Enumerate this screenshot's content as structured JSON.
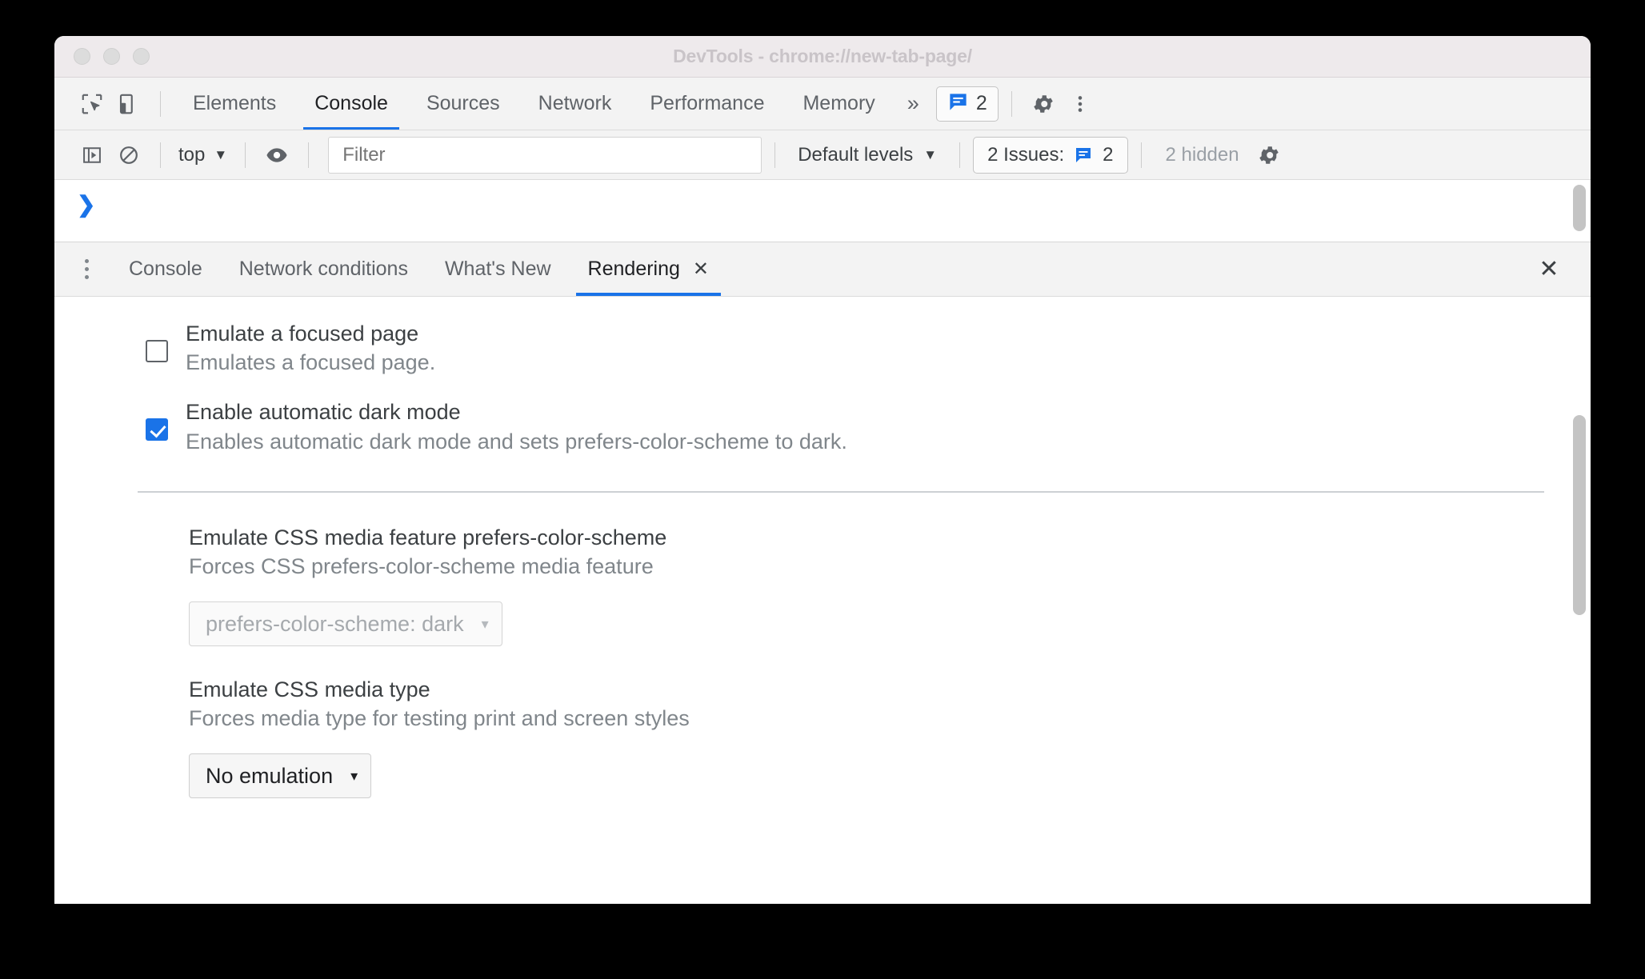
{
  "window": {
    "title": "DevTools - chrome://new-tab-page/",
    "traffic_lights": [
      "close",
      "minimize",
      "zoom"
    ]
  },
  "main_toolbar": {
    "inspect_icon": "inspect-element-icon",
    "device_icon": "device-toolbar-icon",
    "tabs": [
      {
        "label": "Elements",
        "active": false
      },
      {
        "label": "Console",
        "active": true
      },
      {
        "label": "Sources",
        "active": false
      },
      {
        "label": "Network",
        "active": false
      },
      {
        "label": "Performance",
        "active": false
      },
      {
        "label": "Memory",
        "active": false
      }
    ],
    "more_tabs": "»",
    "issues_badge": {
      "icon": "issues-speech-bubble-icon",
      "count": "2"
    },
    "settings_icon": "gear-icon",
    "more_options_icon": "kebab-menu-icon"
  },
  "filter_toolbar": {
    "sidebar_toggle_icon": "console-sidebar-icon",
    "clear_console_icon": "clear-console-icon",
    "context": {
      "label": "top",
      "caret": "▼"
    },
    "eye_icon": "live-expression-eye-icon",
    "filter": {
      "placeholder": "Filter",
      "value": ""
    },
    "levels": {
      "label": "Default levels",
      "caret": "▼"
    },
    "issues": {
      "label": "2 Issues:",
      "icon": "issues-speech-bubble-icon",
      "count": "2"
    },
    "hidden": "2 hidden",
    "settings_icon": "gear-icon"
  },
  "console": {
    "prompt": "❯"
  },
  "drawer": {
    "more_tools_icon": "kebab-menu-icon",
    "tabs": [
      {
        "label": "Console",
        "active": false,
        "closable": false
      },
      {
        "label": "Network conditions",
        "active": false,
        "closable": false
      },
      {
        "label": "What's New",
        "active": false,
        "closable": false
      },
      {
        "label": "Rendering",
        "active": true,
        "closable": true,
        "close": "✕"
      }
    ],
    "close_icon": "✕"
  },
  "rendering": {
    "checkboxes": [
      {
        "title": "Emulate a focused page",
        "description": "Emulates a focused page.",
        "checked": false
      },
      {
        "title": "Enable automatic dark mode",
        "description": "Enables automatic dark mode and sets prefers-color-scheme to dark.",
        "checked": true
      }
    ],
    "sections": [
      {
        "title": "Emulate CSS media feature prefers-color-scheme",
        "description": "Forces CSS prefers-color-scheme media feature",
        "select": {
          "value": "prefers-color-scheme: dark",
          "caret": "▾",
          "disabled": true
        }
      },
      {
        "title": "Emulate CSS media type",
        "description": "Forces media type for testing print and screen styles",
        "select": {
          "value": "No emulation",
          "caret": "▾",
          "disabled": false
        }
      }
    ]
  },
  "colors": {
    "accent": "#1a73e8",
    "titlebar": "#eeeaec",
    "toolbar": "#f3f3f3",
    "text": "#3c4043",
    "muted": "#80868b"
  }
}
